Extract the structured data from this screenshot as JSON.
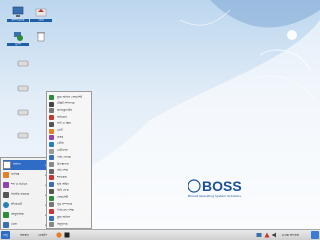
{
  "desktop": {
    "icons": [
      {
        "label": "কম্পিউটার",
        "icon": "computer-icon"
      },
      {
        "label": "হোম",
        "icon": "home-folder-icon"
      },
      {
        "label": "ট্র্যাশ",
        "icon": "trash-icon"
      },
      {
        "label": "",
        "icon": "drive-icon"
      },
      {
        "label": "",
        "icon": "drive-icon"
      },
      {
        "label": "",
        "icon": "drive-icon"
      },
      {
        "label": "",
        "icon": "drive-icon"
      },
      {
        "label": "",
        "icon": "drive-icon"
      },
      {
        "label": "",
        "icon": "drive-icon"
      },
      {
        "label": "",
        "icon": "drive-icon"
      }
    ]
  },
  "logo": {
    "letters": "BOSS",
    "tagline": "Bharat Operating System Solutions"
  },
  "start_menu": {
    "items": [
      {
        "label": "অফিস",
        "icon": "folder-icon",
        "active": true
      },
      {
        "label": "গ্রাফিক্স",
        "icon": "graphics-icon",
        "active": false
      },
      {
        "label": "শব্দ ও ভিডিও",
        "icon": "media-icon",
        "active": false
      },
      {
        "label": "সিস্টেম সরঞ্জাম",
        "icon": "system-icon",
        "active": false
      },
      {
        "label": "ইন্টারনেট",
        "icon": "internet-icon",
        "active": false
      },
      {
        "label": "আনুষাঙ্গিক",
        "icon": "accessories-icon",
        "active": false
      },
      {
        "label": "খেলা",
        "icon": "games-icon",
        "active": false
      }
    ]
  },
  "submenu": {
    "items": [
      {
        "label": "মুক্ত অফিস স্প্রেডশিট",
        "color": "#2e8b3a"
      },
      {
        "label": "টেক্সট সম্পাদক",
        "color": "#444444"
      },
      {
        "label": "ক্যালকুলেটর",
        "color": "#777777"
      },
      {
        "label": "অভিধান",
        "color": "#c0392b"
      },
      {
        "label": "ফন্ট ও স্ক্রিন",
        "color": "#555555"
      },
      {
        "label": "নোট",
        "color": "#e67e22"
      },
      {
        "label": "প্রকল্প",
        "color": "#8e44ad"
      },
      {
        "label": "খোঁজ",
        "color": "#2980b9"
      },
      {
        "label": "ডেটাবেস",
        "color": "#999999"
      },
      {
        "label": "পাঠ্য লেখক",
        "color": "#3a6fb0"
      },
      {
        "label": "উপস্থাপনা",
        "color": "#888888"
      },
      {
        "label": "নথি দর্শক",
        "color": "#666666"
      },
      {
        "label": "শব্দকোষ",
        "color": "#cc3333"
      },
      {
        "label": "ছবি আঁকা",
        "color": "#3a6fb0"
      },
      {
        "label": "চিঠি লেখা",
        "color": "#555555"
      },
      {
        "label": "স্প্রেডশিট",
        "color": "#2e8b3a"
      },
      {
        "label": "সূত্র সম্পাদক",
        "color": "#777777"
      },
      {
        "label": "পিডিএফ দর্শক",
        "color": "#cc3333"
      },
      {
        "label": "মুক্ত অফিস",
        "color": "#3a6fb0"
      },
      {
        "label": "অনুবাদক",
        "color": "#888888"
      }
    ]
  },
  "taskbar": {
    "start_label": "মেনু",
    "buttons": [
      "অবস্থান",
      "ডেস্কটপ"
    ],
    "clock": "2:36 অপরাহ্ন"
  }
}
